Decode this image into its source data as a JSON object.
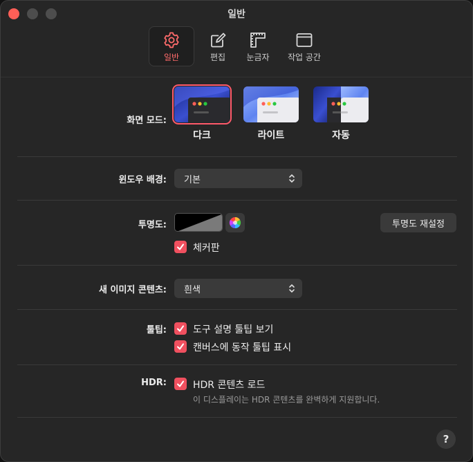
{
  "window": {
    "title": "일반",
    "colors": {
      "accent": "#f0505f",
      "background": "#262626",
      "control": "#3a3a3a"
    }
  },
  "toolbar": {
    "tabs": [
      {
        "label": "일반",
        "icon": "gear-icon",
        "selected": true
      },
      {
        "label": "편집",
        "icon": "edit-icon",
        "selected": false
      },
      {
        "label": "눈금자",
        "icon": "ruler-icon",
        "selected": false
      },
      {
        "label": "작업 공간",
        "icon": "window-icon",
        "selected": false
      }
    ]
  },
  "appearance": {
    "label": "화면 모드:",
    "options": [
      {
        "label": "다크",
        "selected": true
      },
      {
        "label": "라이트",
        "selected": false
      },
      {
        "label": "자동",
        "selected": false
      }
    ]
  },
  "window_background": {
    "label": "윈도우 배경:",
    "value": "기본"
  },
  "transparency": {
    "label": "투명도:",
    "reset_button": "투명도 재설정",
    "checkerboard_label": "체커판",
    "checkerboard_checked": true
  },
  "new_image": {
    "label": "새 이미지 콘텐츠:",
    "value": "흰색"
  },
  "tooltips": {
    "label": "툴팁:",
    "show_tool_tips_label": "도구 설명 툴팁 보기",
    "show_tool_tips_checked": true,
    "canvas_tips_label": "캔버스에 동작 툴팁 표시",
    "canvas_tips_checked": true
  },
  "hdr": {
    "label": "HDR:",
    "load_label": "HDR 콘텐츠 로드",
    "load_checked": true,
    "note": "이 디스플레이는 HDR 콘텐츠를 완벽하게 지원합니다."
  },
  "help": {
    "label": "?"
  }
}
